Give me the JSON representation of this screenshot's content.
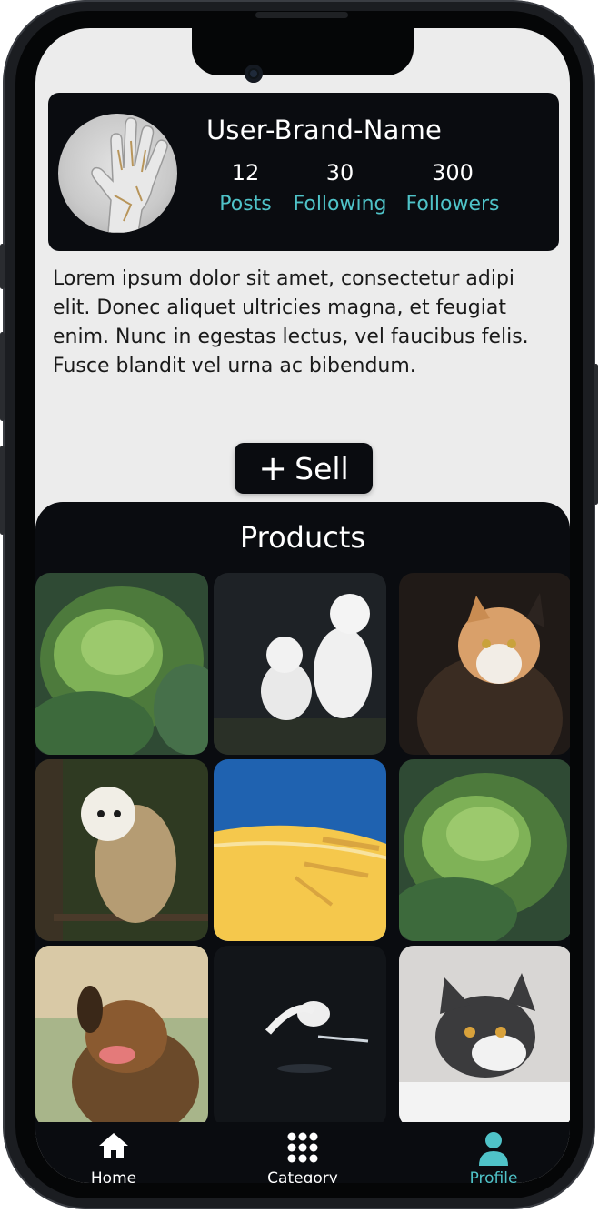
{
  "profile": {
    "brand_name": "User-Brand-Name",
    "stats": [
      {
        "value": "12",
        "label": "Posts"
      },
      {
        "value": "30",
        "label": "Following"
      },
      {
        "value": "300",
        "label": "Followers"
      }
    ],
    "bio": "Lorem ipsum dolor sit amet, consectetur adipi elit. Donec aliquet ultricies magna, et feugiat enim. Nunc in egestas lectus, vel faucibus felis. Fusce blandit vel urna ac bibendum."
  },
  "sell_button": {
    "icon": "plus-icon",
    "label": "Sell"
  },
  "products": {
    "title": "Products",
    "items": [
      {
        "name": "cabbage"
      },
      {
        "name": "kittens"
      },
      {
        "name": "calico-cat"
      },
      {
        "name": "barn-owl"
      },
      {
        "name": "wheat-illustration"
      },
      {
        "name": "cabbage"
      },
      {
        "name": "dog"
      },
      {
        "name": "egret"
      },
      {
        "name": "grey-cat"
      }
    ]
  },
  "nav": {
    "items": [
      {
        "icon": "home-icon",
        "label": "Home"
      },
      {
        "icon": "grid-icon",
        "label": "Category"
      },
      {
        "icon": "profile-icon",
        "label": "Profile"
      }
    ],
    "active_color": "#4fc3c8",
    "inactive_color": "#ffffff"
  }
}
